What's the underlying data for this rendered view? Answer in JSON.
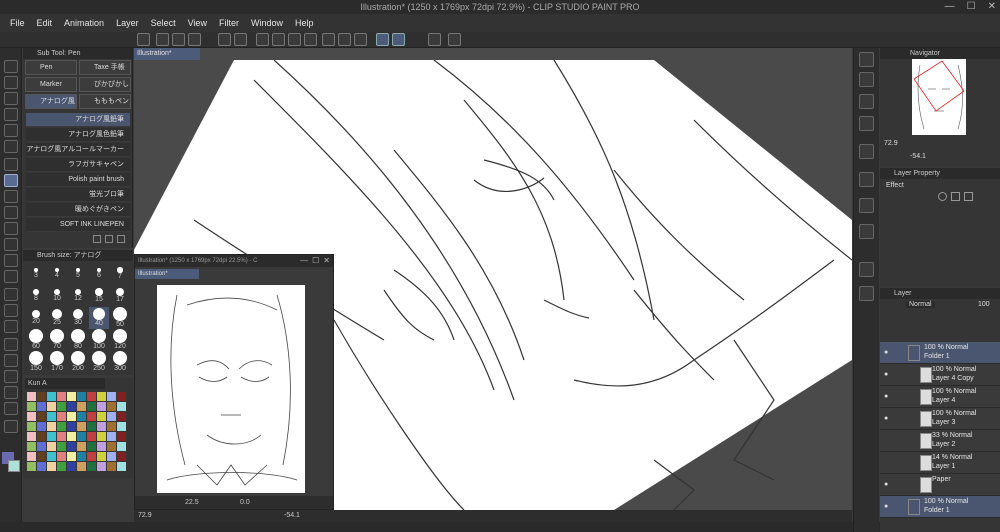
{
  "window": {
    "title": "Illustration* (1250 x 1769px 72dpi 72.9%) - CLIP STUDIO PAINT PRO",
    "controls": [
      "—",
      "☐",
      "✕"
    ]
  },
  "menu": [
    "File",
    "Edit",
    "Animation",
    "Layer",
    "Select",
    "View",
    "Filter",
    "Window",
    "Help"
  ],
  "subtool": {
    "header": "Sub Tool: Pen",
    "groups": [
      {
        "label": "Pen",
        "selected": false
      },
      {
        "label": "Taxe 手帳",
        "selected": false
      },
      {
        "label": "Marker",
        "selected": false
      },
      {
        "label": "ぴかぴかし",
        "selected": false
      },
      {
        "label": "アナログ風",
        "selected": true
      },
      {
        "label": "もももペン",
        "selected": false
      }
    ],
    "brushes": [
      {
        "label": "アナログ風鉛筆",
        "selected": true
      },
      {
        "label": "アナログ風色鉛筆",
        "selected": false
      },
      {
        "label": "アナログ風アルコールマーカー",
        "selected": false
      },
      {
        "label": "ラフガサキャペン",
        "selected": false
      },
      {
        "label": "Polish paint brush",
        "selected": false
      },
      {
        "label": "蛍光ブロ筆",
        "selected": false
      },
      {
        "label": "暖めぐがきペン",
        "selected": false
      },
      {
        "label": "SOFT INK LINEPEN",
        "selected": false
      }
    ]
  },
  "brushsize": {
    "header": "Brush size: アナログ",
    "sizes": [
      "3",
      "4",
      "5",
      "6",
      "7",
      "8",
      "10",
      "12",
      "15",
      "17",
      "20",
      "25",
      "30",
      "40",
      "50",
      "60",
      "70",
      "80",
      "100",
      "120",
      "150",
      "170",
      "200",
      "250",
      "300"
    ],
    "selected": "40"
  },
  "colorset": {
    "name": "Kun A",
    "main_color": "#6a6ab0",
    "sub_color": "#aee0d8"
  },
  "canvas": {
    "tab": "Illustration*",
    "zoom": "72.9",
    "rotation": "-54.1"
  },
  "subview": {
    "title": "Illustration* (1250 x 1769px 72dpi 22.5%) - C",
    "tab": "Illustration*",
    "zoom": "22.5",
    "angle": "0.0"
  },
  "navigator": {
    "header": "Navigator",
    "zoom": "72.9",
    "rotation": "-54.1"
  },
  "layer_property": {
    "header": "Layer Property",
    "effect_label": "Effect"
  },
  "layers": {
    "header": "Layer",
    "blend": "Normal",
    "opacity": "100",
    "items": [
      {
        "opacity": "100 % Normal",
        "name": "Folder 1",
        "type": "folder",
        "selected": true,
        "visible": true
      },
      {
        "opacity": "100 % Normal",
        "name": "Layer 4 Copy",
        "type": "layer",
        "selected": false,
        "visible": true
      },
      {
        "opacity": "100 % Normal",
        "name": "Layer 4",
        "type": "layer",
        "selected": false,
        "visible": true
      },
      {
        "opacity": "100 % Normal",
        "name": "Layer 3",
        "type": "layer",
        "selected": false,
        "visible": true
      },
      {
        "opacity": "33 % Normal",
        "name": "Layer 2",
        "type": "layer",
        "selected": false,
        "visible": false
      },
      {
        "opacity": "14 % Normal",
        "name": "Layer 1",
        "type": "layer",
        "selected": false,
        "visible": false
      },
      {
        "opacity": "",
        "name": "Paper",
        "type": "paper",
        "selected": false,
        "visible": true
      },
      {
        "opacity": "100 % Normal",
        "name": "Folder 1",
        "type": "folder",
        "selected": true,
        "visible": true
      }
    ]
  }
}
